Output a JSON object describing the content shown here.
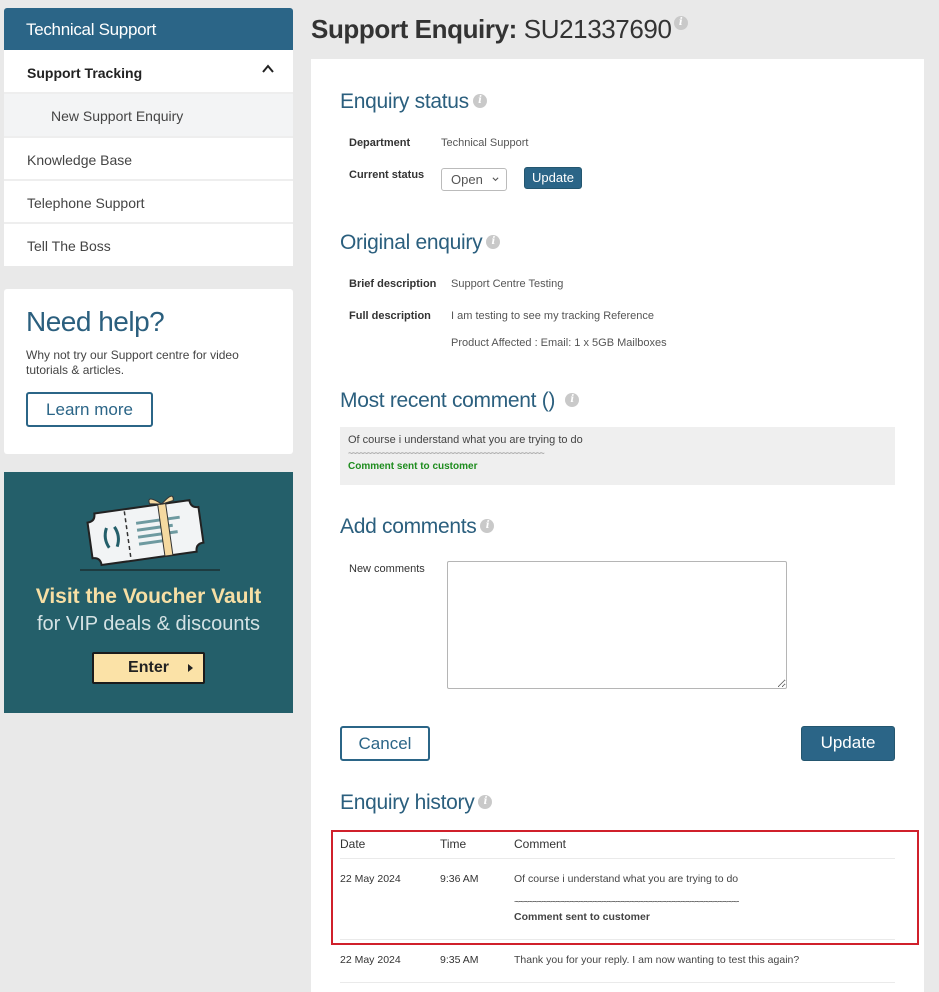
{
  "sidebar": {
    "header": "Technical Support",
    "items": [
      {
        "label": "Support Tracking",
        "expanded": true
      },
      {
        "label": "New Support Enquiry",
        "sub": true
      },
      {
        "label": "Knowledge Base"
      },
      {
        "label": "Telephone Support"
      },
      {
        "label": "Tell The Boss"
      }
    ]
  },
  "help_card": {
    "title": "Need help?",
    "text": "Why not try our Support centre for video tutorials & articles.",
    "button": "Learn more"
  },
  "promo": {
    "title": "Visit the Voucher Vault",
    "subtitle": "for VIP deals & discounts",
    "button": "Enter",
    "colors": {
      "background": "#245f6a",
      "accent": "#fbe2a7"
    }
  },
  "page": {
    "title_prefix": "Support Enquiry:",
    "reference": "SU21337690"
  },
  "status_section": {
    "heading": "Enquiry status",
    "department_label": "Department",
    "department_value": "Technical Support",
    "status_label": "Current status",
    "status_selected": "Open",
    "update_button": "Update"
  },
  "original_section": {
    "heading": "Original enquiry",
    "brief_label": "Brief description",
    "brief_value": "Support Centre Testing",
    "full_label": "Full description",
    "full_value_line1": "I am testing to see my tracking Reference",
    "full_value_line2": "Product Affected : Email: 1 x 5GB Mailboxes"
  },
  "recent_section": {
    "heading": "Most recent comment ()",
    "comment": "Of course i understand what you are trying to do",
    "separator": "~~~~~~~~~~~~~~~~~~~~~~~~~~~~~~~~~~~~~~~~~~~~~~~~~~~~",
    "status": "Comment sent to customer"
  },
  "add_section": {
    "heading": "Add comments",
    "label": "New comments",
    "value": "",
    "cancel_button": "Cancel",
    "update_button": "Update"
  },
  "history": {
    "heading": "Enquiry history",
    "columns": [
      "Date",
      "Time",
      "Comment"
    ],
    "rows": [
      {
        "date": "22 May 2024",
        "time": "9:36 AM",
        "comment": "Of course i understand what you are trying to do",
        "separator": "~~~~~~~~~~~~~~~~~~~~~~~~~~~~~~~~~~~~~~~~~~~~~~~~~~~~",
        "status": "Comment sent to customer",
        "highlighted": true
      },
      {
        "date": "22 May 2024",
        "time": "9:35 AM",
        "comment": "Thank you for your reply. I am now wanting to test this again?"
      }
    ]
  },
  "colors": {
    "brand": "#2b6587",
    "heading": "#2b5f7e",
    "success": "#1e8c1e",
    "highlight_border": "#d0202b"
  }
}
